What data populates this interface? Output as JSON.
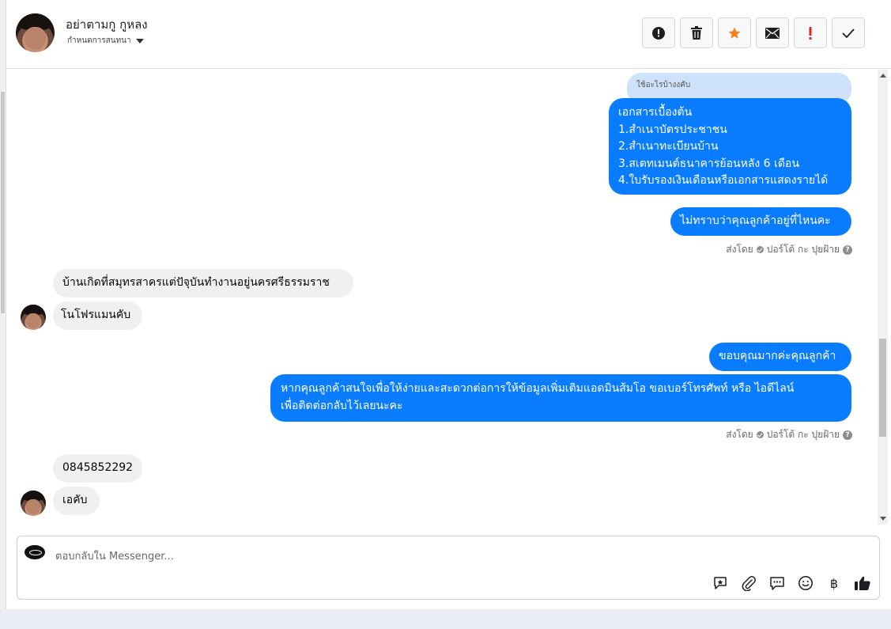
{
  "header": {
    "name": "อย่าตามกู กูหลง",
    "assign_label": "กำหนดการสนทนา",
    "actions": [
      {
        "name": "spam-button",
        "icon": "alert-circle-icon"
      },
      {
        "name": "delete-button",
        "icon": "trash-icon"
      },
      {
        "name": "star-button",
        "icon": "star-icon"
      },
      {
        "name": "mark-unread-button",
        "icon": "envelope-icon"
      },
      {
        "name": "important-button",
        "icon": "exclamation-icon"
      },
      {
        "name": "done-button",
        "icon": "check-icon"
      }
    ]
  },
  "conversation": {
    "quote_text": "ใช้อะไรบ้างงคับ",
    "msg1": "เอกสารเบื้องต้น\n1.สำเนาบัตรประชาชน\n2.สำเนาทะเบียนบ้าน\n3.สเตทเมนต์ธนาคารย้อนหลัง 6 เดือน\n4.ใบรับรองเงินเดือนหรือเอกสารแสดงรายได้",
    "msg2": "ไม่ทราบว่าคุณลูกค้าอยู่ที่ไหนคะ",
    "sent_by_prefix": "ส่งโดย",
    "sent_by_name": "ปอร์โต้ กะ ปุยฝ้าย",
    "msg3": "บ้านเกิดที่สมุทรสาครแต่ปัจุบันทำงานอยู่นครศรีธรรมราช",
    "msg4": "โนโฟรแมนคับ",
    "msg5": "ขอบคุณมากค่ะคุณลูกค้า",
    "msg6": "หากคุณลูกค้าสนใจเพื่อให้ง่ายและสะดวกต่อการให้ข้อมูลเพิ่มเติมแอดมินส้มโอ ขอเบอร์โทรศัพท์ หรือ ไอดีไลน์\nเพื่อติดต่อกลับไว้เลยนะคะ",
    "msg7": "0845852292",
    "msg8": "เอคับ"
  },
  "composer": {
    "placeholder": "ตอบกลับใน Messenger...",
    "icons": [
      "saved-reply-icon",
      "attachment-icon",
      "chat-bubbles-icon",
      "emoji-icon",
      "baht-icon",
      "thumbs-up-icon"
    ],
    "baht_symbol": "฿"
  },
  "colors": {
    "outgoing": "#0a7cff",
    "incoming": "#f0f0f0",
    "quote": "#cfe2fb",
    "star": "#f5821f",
    "important": "#e02424"
  }
}
